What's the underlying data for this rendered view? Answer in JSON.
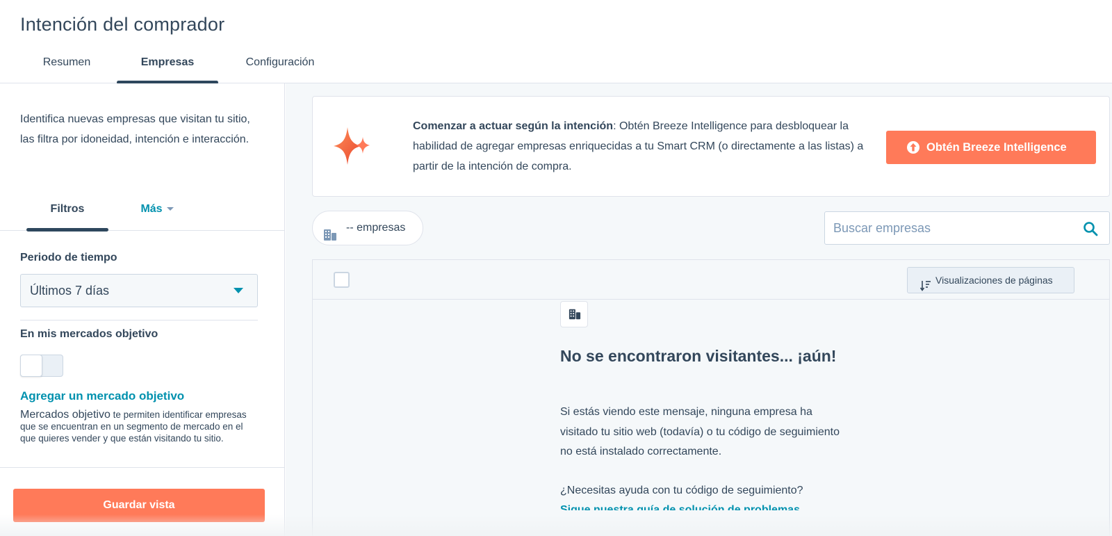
{
  "page": {
    "title": "Intención del comprador"
  },
  "tabs": [
    {
      "label": "Resumen"
    },
    {
      "label": "Empresas"
    },
    {
      "label": "Configuración"
    }
  ],
  "sidebar": {
    "description": "Identifica nuevas empresas que visitan tu sitio, las filtra por idoneidad, intención e interacción.",
    "subtabs": {
      "filters": "Filtros",
      "more": "Más"
    },
    "time_period": {
      "label": "Periodo de tiempo",
      "value": "Últimos 7 días"
    },
    "target_markets": {
      "label": "En mis mercados objetivo",
      "toggle_on": false,
      "add_link": "Agregar un mercado objetivo",
      "help_lead": "Mercados objetivo",
      "help_rest": " te permiten identificar empresas que se encuentran en un segmento de mercado en el que quieres vender y que están visitando tu sitio."
    },
    "save_button": "Guardar vista"
  },
  "banner": {
    "bold": "Comenzar a actuar según la intención",
    "text": ": Obtén Breeze Intelligence para desbloquear la habilidad de agregar empresas enriquecidas a tu Smart CRM (o directamente a las listas) a partir de la intención de compra.",
    "button": "Obtén Breeze Intelligence",
    "accent": "#ff7a59"
  },
  "toolbar": {
    "count_label": "-- empresas",
    "search_placeholder": "Buscar empresas"
  },
  "table": {
    "sort_button": "Visualizaciones de páginas"
  },
  "empty_state": {
    "title": "No se encontraron visitantes... ¡aún!",
    "body": "Si estás viendo este mensaje, ninguna empresa ha visitado tu sitio web (todavía) o tu código de seguimiento no está instalado correctamente.",
    "help_question": "¿Necesitas ayuda con tu código de seguimiento?",
    "help_link": "Sigue nuestra guía de solución de problemas"
  },
  "icons": {
    "spark": "sparkle-icon",
    "building": "building-icon",
    "search": "search-icon",
    "sort": "sort-icon",
    "upload": "arrow-up-circle-icon"
  },
  "colors": {
    "primary_text": "#33475b",
    "link": "#0091ae",
    "accent": "#ff7a59",
    "border": "#dfe3eb",
    "background": "#f5f8fa"
  }
}
